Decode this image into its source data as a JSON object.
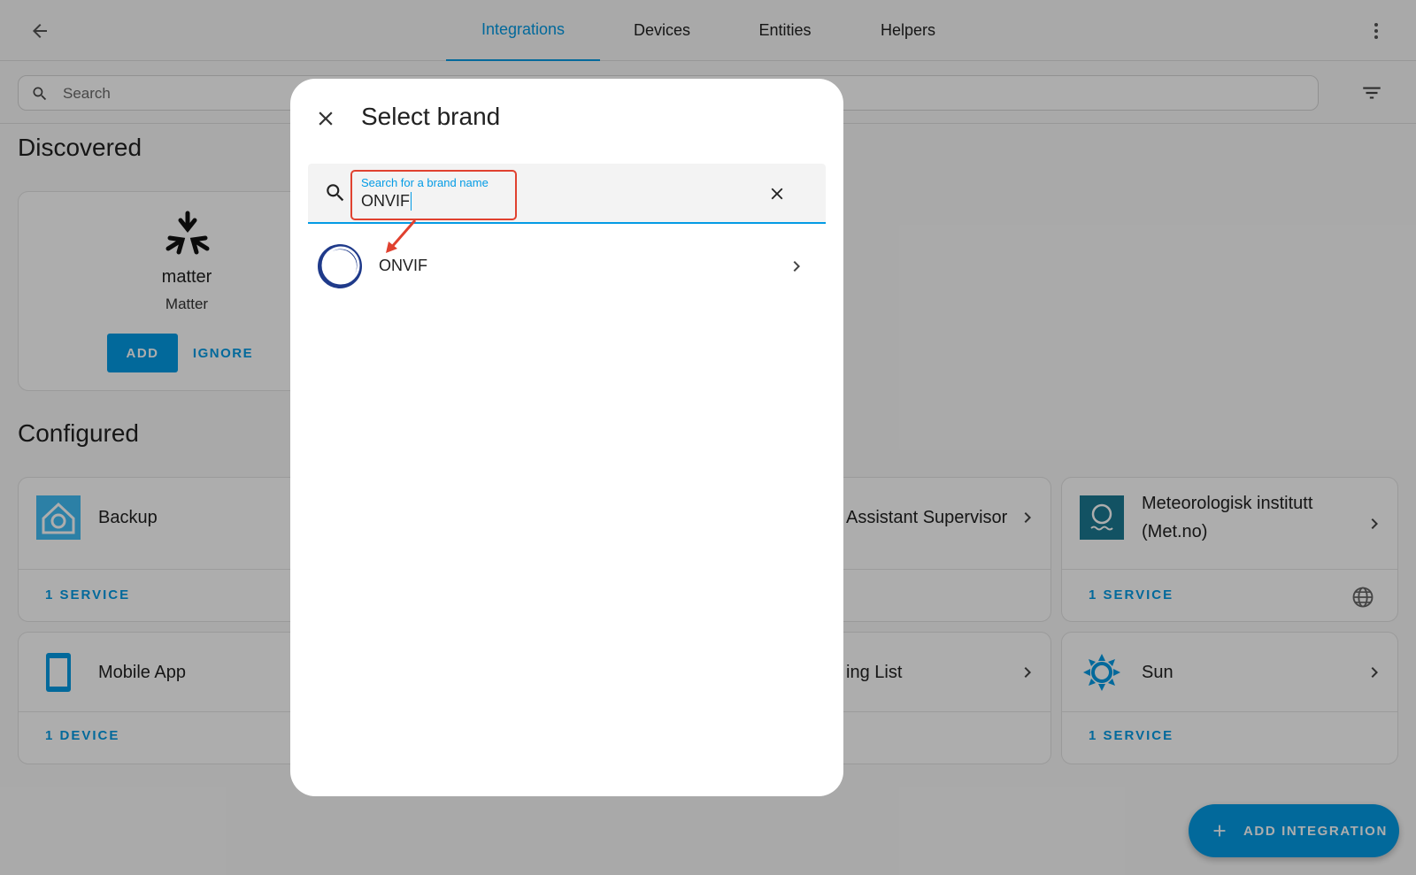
{
  "app": {
    "tabs": [
      {
        "label": "Integrations",
        "active": true
      },
      {
        "label": "Devices",
        "active": false
      },
      {
        "label": "Entities",
        "active": false
      },
      {
        "label": "Helpers",
        "active": false
      }
    ],
    "search": {
      "placeholder": "Search"
    },
    "icons": {
      "back": "arrow-left-icon",
      "more": "dots-vertical-icon",
      "filter": "filter-icon",
      "search": "magnify-icon"
    }
  },
  "discovered": {
    "title": "Discovered",
    "card": {
      "name": "matter",
      "subtitle": "Matter",
      "add_label": "ADD",
      "ignore_label": "IGNORE"
    }
  },
  "configured": {
    "title": "Configured",
    "cards": {
      "backup": {
        "name": "Backup",
        "footer": "1 SERVICE"
      },
      "supervisor": {
        "name": "Assistant Supervisor"
      },
      "met": {
        "name_line1": "Meteorologisk institutt",
        "name_line2": "(Met.no)",
        "footer": "1 SERVICE"
      },
      "mobile": {
        "name": "Mobile App",
        "footer": "1 DEVICE"
      },
      "shopping": {
        "name": "ing List"
      },
      "sun": {
        "name": "Sun",
        "footer": "1 SERVICE"
      }
    }
  },
  "fab": {
    "label": "ADD INTEGRATION"
  },
  "dialog": {
    "title": "Select brand",
    "search": {
      "label": "Search for a brand name",
      "value": "ONVIF"
    },
    "results": [
      {
        "name": "ONVIF",
        "icon": "onvif-logo"
      }
    ]
  },
  "colors": {
    "accent": "#039be5",
    "highlight": "#e0412f",
    "ha_blue": "#41bdf5",
    "met_teal": "#1b7a92"
  }
}
